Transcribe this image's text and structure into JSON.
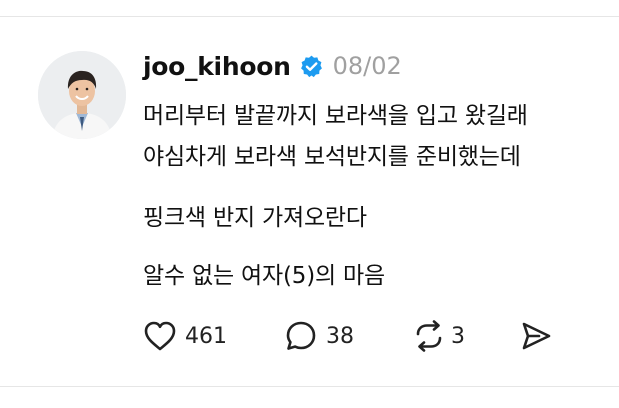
{
  "post": {
    "username": "joo_kihoon",
    "verified_icon": "verified-badge-icon",
    "date": "08/02",
    "lines": [
      "머리부터 발끝까지 보라색을 입고 왔길래",
      "야심차게 보라색 보석반지를 준비했는데",
      "핑크색 반지 가져오란다",
      "알수 없는 여자(5)의 마음"
    ]
  },
  "actions": {
    "like_icon": "heart-icon",
    "like_count": "461",
    "comment_icon": "comment-bubble-icon",
    "comment_count": "38",
    "repost_icon": "repost-icon",
    "repost_count": "3",
    "share_icon": "send-icon"
  },
  "colors": {
    "verified": "#1d9bf0",
    "date": "#a0a0a0",
    "icon": "#222222"
  }
}
